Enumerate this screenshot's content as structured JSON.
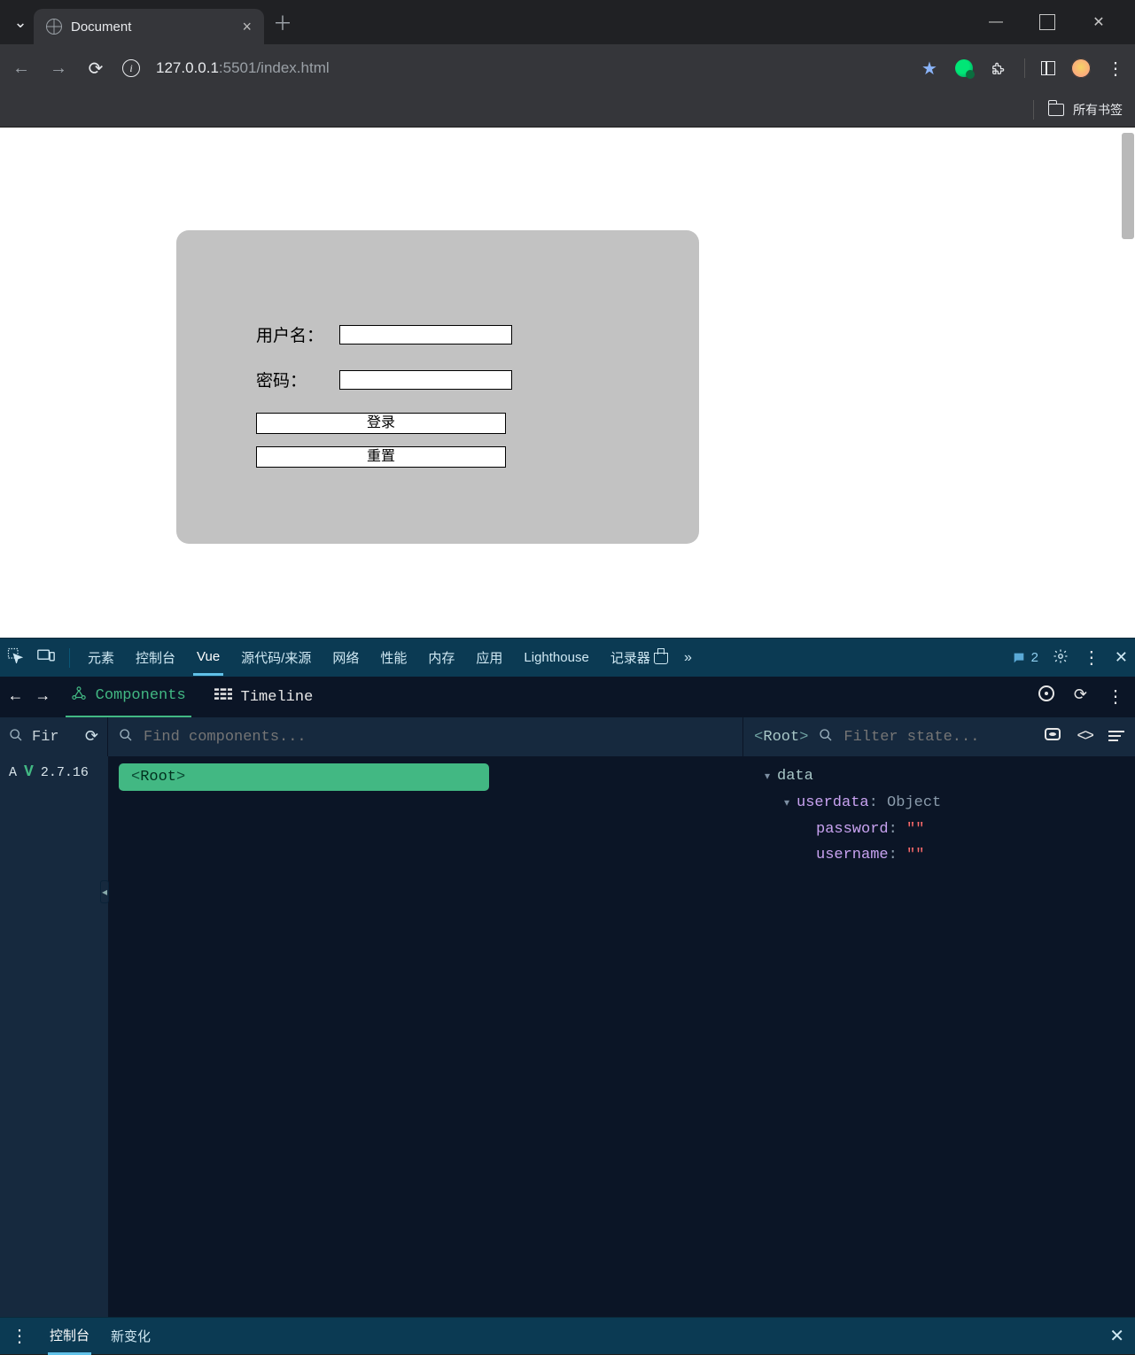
{
  "browser": {
    "tab_title": "Document",
    "url_host": "127.0.0.1",
    "url_port_path": ":5501/index.html",
    "bookmarks_label": "所有书签"
  },
  "page": {
    "username_label": "用户名：",
    "password_label": "密码：",
    "login_btn": "登录",
    "reset_btn": "重置"
  },
  "devtools": {
    "tabs": {
      "elements": "元素",
      "console": "控制台",
      "vue": "Vue",
      "sources": "源代码/来源",
      "network": "网络",
      "performance": "性能",
      "memory": "内存",
      "application": "应用",
      "lighthouse": "Lighthouse",
      "recorder": "记录器"
    },
    "msg_count": "2"
  },
  "vuedev": {
    "components_tab": "Components",
    "timeline_tab": "Timeline",
    "app_filter_value": "Fir",
    "find_placeholder": "Find components...",
    "state_filter_placeholder": "Filter state...",
    "root_label": "Root",
    "app_label": "A",
    "version": "2.7.16",
    "tree_root": "Root",
    "state": {
      "section": "data",
      "obj_key": "userdata",
      "obj_type": "Object",
      "password_key": "password",
      "password_val": "\"\"",
      "username_key": "username",
      "username_val": "\"\""
    }
  },
  "drawer": {
    "console": "控制台",
    "whatsnew": "新变化"
  }
}
